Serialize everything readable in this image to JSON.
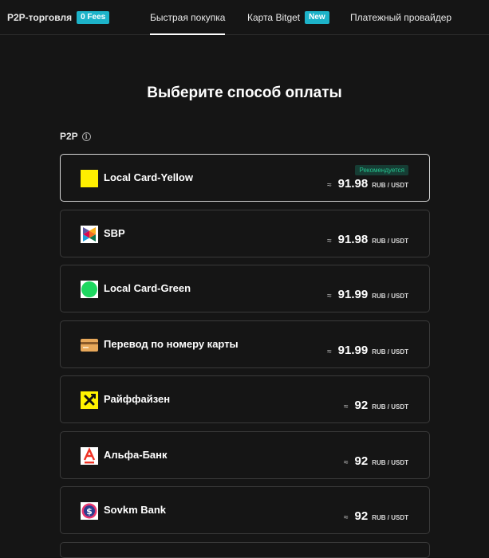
{
  "nav": {
    "p2p_label": "P2P-торговля",
    "p2p_badge": "0 Fees",
    "quick_buy_label": "Быстрая покупка",
    "card_label": "Карта Bitget",
    "card_badge": "New",
    "provider_label": "Платежный провайдер"
  },
  "main": {
    "heading": "Выберите способ оплаты",
    "section_label": "P2P"
  },
  "methods": [
    {
      "name": "Local Card-Yellow",
      "approx": "≈",
      "value": "91.98",
      "unit": "RUB / USDT",
      "badge": "Рекомендуется",
      "icon": "yellow-square-icon"
    },
    {
      "name": "SBP",
      "approx": "≈",
      "value": "91.98",
      "unit": "RUB / USDT",
      "icon": "sbp-logo-icon"
    },
    {
      "name": "Local Card-Green",
      "approx": "≈",
      "value": "91.99",
      "unit": "RUB / USDT",
      "icon": "green-circle-icon"
    },
    {
      "name": "Перевод по номеру карты",
      "approx": "≈",
      "value": "91.99",
      "unit": "RUB / USDT",
      "icon": "bank-card-icon"
    },
    {
      "name": "Райффайзен",
      "approx": "≈",
      "value": "92",
      "unit": "RUB / USDT",
      "icon": "raiffeisen-logo-icon"
    },
    {
      "name": "Альфа-Банк",
      "approx": "≈",
      "value": "92",
      "unit": "RUB / USDT",
      "icon": "alfa-bank-logo-icon"
    },
    {
      "name": "Sovkm Bank",
      "approx": "≈",
      "value": "92",
      "unit": "RUB / USDT",
      "icon": "sovkom-logo-icon"
    }
  ],
  "colors": {
    "background": "#151515",
    "accent_badge": "#1db3c9",
    "recommended_text": "#25c48f"
  }
}
